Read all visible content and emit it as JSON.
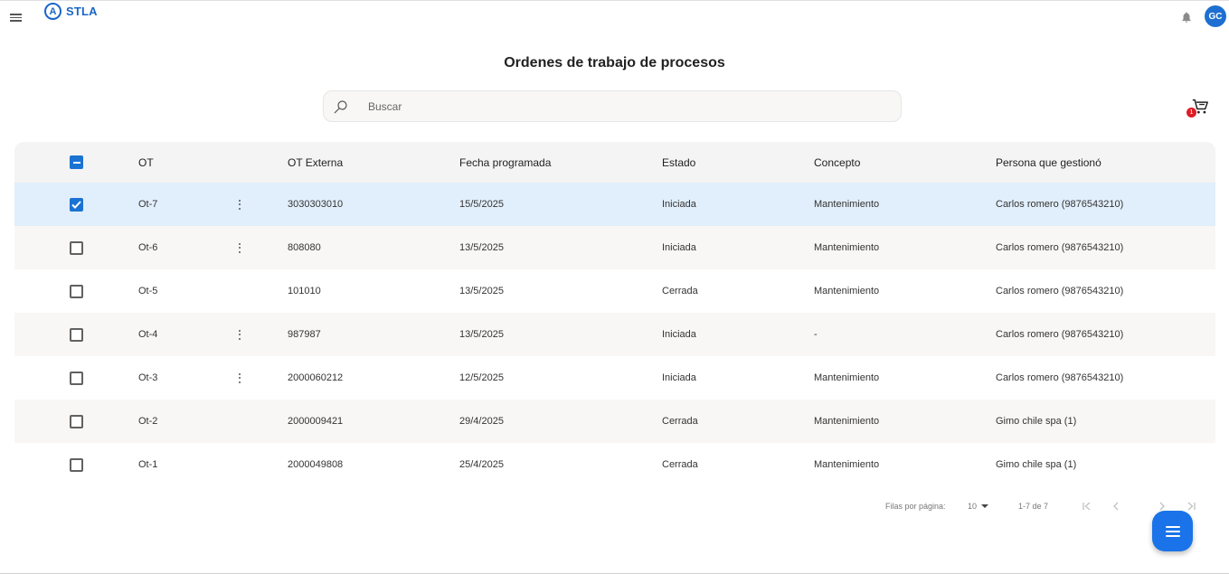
{
  "header": {
    "brand_letter": "A",
    "brand_name": "STLA",
    "avatar_initials": "GC"
  },
  "page": {
    "title": "Ordenes de trabajo de procesos"
  },
  "search": {
    "placeholder": "Buscar",
    "value": ""
  },
  "cart": {
    "badge_count": "1"
  },
  "table": {
    "columns": [
      "OT",
      "OT Externa",
      "Fecha programada",
      "Estado",
      "Concepto",
      "Persona que gestionó"
    ],
    "rows": [
      {
        "ot": "Ot-7",
        "ext": "3030303010",
        "fecha": "15/5/2025",
        "estado": "Iniciada",
        "concepto": "Mantenimiento",
        "persona": "Carlos romero  (9876543210)"
      },
      {
        "ot": "Ot-6",
        "ext": "808080",
        "fecha": "13/5/2025",
        "estado": "Iniciada",
        "concepto": "Mantenimiento",
        "persona": "Carlos romero  (9876543210)"
      },
      {
        "ot": "Ot-5",
        "ext": "101010",
        "fecha": "13/5/2025",
        "estado": "Cerrada",
        "concepto": "Mantenimiento",
        "persona": "Carlos romero  (9876543210)"
      },
      {
        "ot": "Ot-4",
        "ext": "987987",
        "fecha": "13/5/2025",
        "estado": "Iniciada",
        "concepto": "-",
        "persona": "Carlos romero  (9876543210)"
      },
      {
        "ot": "Ot-3",
        "ext": "2000060212",
        "fecha": "12/5/2025",
        "estado": "Iniciada",
        "concepto": "Mantenimiento",
        "persona": "Carlos romero  (9876543210)"
      },
      {
        "ot": "Ot-2",
        "ext": "2000009421",
        "fecha": "29/4/2025",
        "estado": "Cerrada",
        "concepto": "Mantenimiento",
        "persona": "Gimo chile spa (1)"
      },
      {
        "ot": "Ot-1",
        "ext": "2000049808",
        "fecha": "25/4/2025",
        "estado": "Cerrada",
        "concepto": "Mantenimiento",
        "persona": "Gimo chile spa (1)"
      }
    ]
  },
  "pagination": {
    "rows_label": "Filas por página:",
    "rows_per_page": "10",
    "range": "1-7 de 7"
  },
  "colors": {
    "accent": "#1a73d2",
    "selected_row": "#e1eefb",
    "badge": "#e01b24"
  }
}
